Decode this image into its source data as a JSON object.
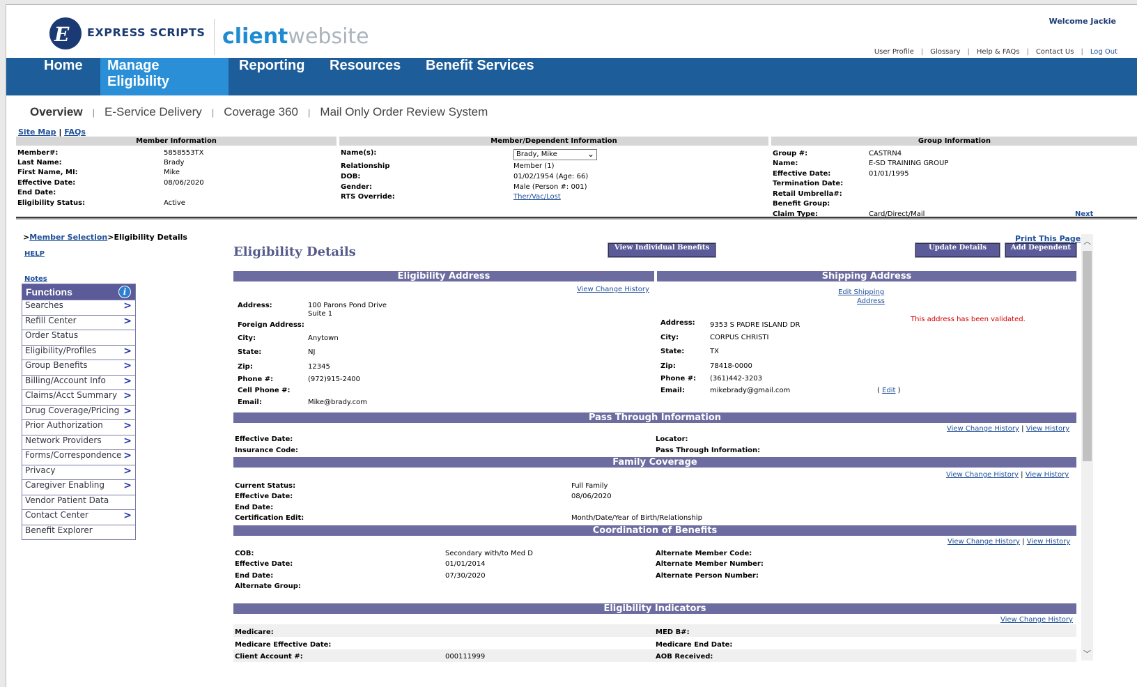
{
  "header": {
    "logo_text": "EXPRESS SCRIPTS",
    "brand_bold": "client",
    "brand_light": "website",
    "welcome": "Welcome Jackie",
    "util_links": [
      "User Profile",
      "Glossary",
      "Help & FAQs",
      "Contact Us",
      "Log Out"
    ]
  },
  "mainnav": [
    "Home",
    "Manage Eligibility",
    "Reporting",
    "Resources",
    "Benefit Services"
  ],
  "subnav": [
    "Overview",
    "E-Service Delivery",
    "Coverage 360",
    "Mail Only Order Review System"
  ],
  "sitemap": {
    "a": "Site Map",
    "sep": "|",
    "b": "FAQs"
  },
  "member_info": {
    "title": "Member Information",
    "labels": [
      "Member#:",
      "Last Name:",
      "First Name, MI:",
      "Effective Date:",
      "End Date:",
      "Eligibility Status:"
    ],
    "values": [
      "5858553TX",
      "Brady",
      "Mike",
      "08/06/2020",
      "",
      "Active"
    ]
  },
  "dependent_info": {
    "title": "Member/Dependent Information",
    "labels": [
      "Name(s):",
      "Relationship",
      "DOB:",
      "Gender:",
      "RTS Override:"
    ],
    "name_select": "Brady, Mike",
    "values": [
      "Member (1)",
      "01/02/1954 (Age: 66)",
      "Male (Person #: 001)"
    ],
    "rts_link": "Ther/Vac/Lost"
  },
  "group_info": {
    "title": "Group Information",
    "labels": [
      "Group #:",
      "Name:",
      "Effective Date:",
      "Termination Date:",
      "Retail Umbrella#:",
      "Benefit Group:",
      "Claim Type:"
    ],
    "values": [
      "CASTRN4",
      "E-SD TRAINING GROUP",
      "01/01/1995",
      "",
      "",
      "",
      "Card/Direct/Mail"
    ],
    "next": "Next"
  },
  "breadcrumb": {
    "prefix": ">",
    "link": "Member Selection",
    "current": ">Eligibility Details"
  },
  "left": {
    "help": "HELP",
    "notes": "Notes"
  },
  "functions": {
    "title": "Functions",
    "items": [
      {
        "label": "Searches",
        "arrow": true
      },
      {
        "label": "Refill Center",
        "arrow": true
      },
      {
        "label": "Order Status",
        "arrow": false
      },
      {
        "label": "Eligibility/Profiles",
        "arrow": true
      },
      {
        "label": "Group Benefits",
        "arrow": true
      },
      {
        "label": "Billing/Account Info",
        "arrow": true
      },
      {
        "label": "Claims/Acct Summary",
        "arrow": true
      },
      {
        "label": "Drug Coverage/Pricing",
        "arrow": true
      },
      {
        "label": "Prior Authorization",
        "arrow": true
      },
      {
        "label": "Network Providers",
        "arrow": true
      },
      {
        "label": "Forms/Correspondence",
        "arrow": true
      },
      {
        "label": "Privacy",
        "arrow": true
      },
      {
        "label": "Caregiver Enabling",
        "arrow": true
      },
      {
        "label": "Vendor Patient Data",
        "arrow": false
      },
      {
        "label": "Contact Center",
        "arrow": true
      },
      {
        "label": "Benefit Explorer",
        "arrow": false
      }
    ]
  },
  "main": {
    "title": "Eligibility Details",
    "print": "Print This Page",
    "buttons": {
      "view_individual": "View Individual Benefits",
      "update": "Update Details",
      "add_dependent": "Add Dependent"
    },
    "eligibility_address": {
      "title": "Eligibility Address",
      "change_history": "View Change History",
      "labels": [
        "Address:",
        "Foreign Address:",
        "City:",
        "State:",
        "Zip:",
        "Phone #:",
        "Cell Phone #:",
        "Email:"
      ],
      "address_line1": "100 Parons Pond Drive",
      "address_line2": "Suite 1",
      "city": "Anytown",
      "state": "NJ",
      "zip": "12345",
      "phone": "(972)915-2400",
      "email": "Mike@brady.com"
    },
    "shipping_address": {
      "title": "Shipping Address",
      "edit_link_1": "Edit Shipping",
      "edit_link_2": "Address",
      "validated": "This address has been validated.",
      "labels": [
        "Address:",
        "City:",
        "State:",
        "Zip:",
        "Phone #:",
        "Email:"
      ],
      "values": [
        "9353 S PADRE ISLAND DR",
        "CORPUS CHRISTI",
        "TX",
        "78418-0000",
        "(361)442-3203",
        "mikebrady@gmail.com"
      ],
      "edit_open": "(",
      "edit": "Edit",
      "edit_close": ")"
    },
    "pass_through": {
      "title": "Pass Through Information",
      "change_history": "View Change History",
      "sep": "|",
      "history": "View History",
      "left_labels": [
        "Effective Date:",
        "Insurance Code:"
      ],
      "right_labels": [
        "Locator:",
        "Pass Through Information:"
      ]
    },
    "family": {
      "title": "Family Coverage",
      "change_history": "View Change History",
      "sep": "|",
      "history": "View History",
      "labels": [
        "Current Status:",
        "Effective Date:",
        "End Date:",
        "Certification Edit:"
      ],
      "values": [
        "Full Family",
        "08/06/2020",
        "",
        "Month/Date/Year of Birth/Relationship"
      ]
    },
    "cob": {
      "title": "Coordination of Benefits",
      "change_history": "View Change History",
      "sep": "|",
      "history": "View History",
      "labels": [
        "COB:",
        "Effective Date:",
        "End Date:",
        "Alternate Group:"
      ],
      "values": [
        "Secondary with/to Med D",
        "01/01/2014",
        "07/30/2020",
        ""
      ],
      "right_labels": [
        "Alternate Member Code:",
        "Alternate Member Number:",
        "Alternate Person Number:"
      ]
    },
    "indicators": {
      "title": "Eligibility Indicators",
      "change_history": "View Change History",
      "left_labels": [
        "Medicare:",
        "Medicare Effective Date:",
        "Client Account #:"
      ],
      "left_values": [
        "",
        "",
        "000111999"
      ],
      "right_labels": [
        "MED B#:",
        "Medicare End Date:",
        "AOB Received:"
      ]
    }
  }
}
